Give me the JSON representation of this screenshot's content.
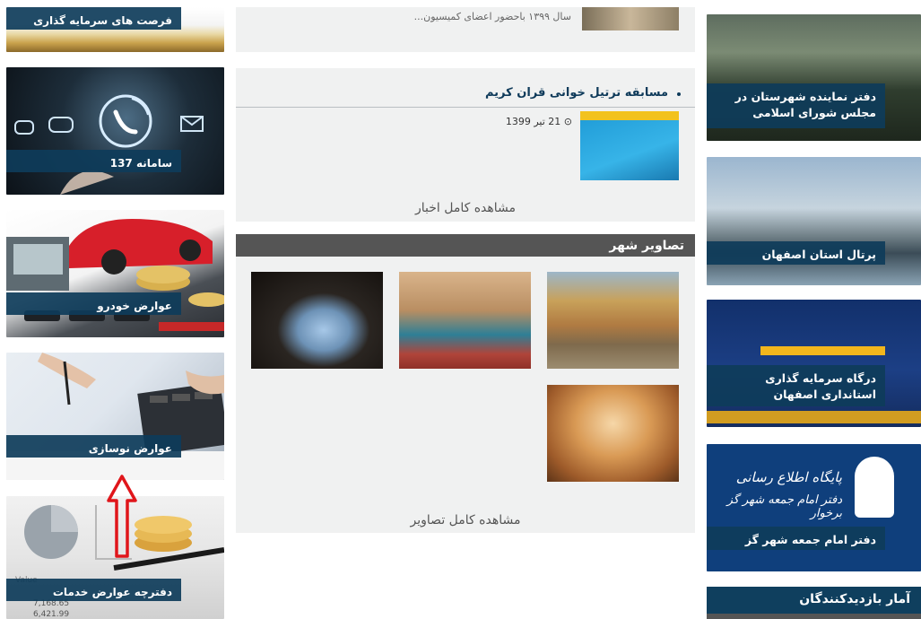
{
  "left_tiles": [
    {
      "label": "فرصت های سرمایه گذاری"
    },
    {
      "label": "سامانه 137"
    },
    {
      "label": "عوارض خودرو"
    },
    {
      "label": "عوارض نوسازی"
    },
    {
      "label": "دفترچه عوارض خدمات"
    }
  ],
  "news": {
    "prev_snippet": "سال ۱۳۹۹ باحضور اعضای کمیسیون...",
    "item_title": "مسابقه ترتیل خوانی قران کریم",
    "item_date": "21 تیر 1399",
    "more_label": "مشاهده کامل اخبار"
  },
  "gallery": {
    "title": "تصاویر شهر",
    "more_label": "مشاهده کامل تصاویر",
    "images": [
      "city-image-1",
      "city-image-2",
      "city-image-3",
      "city-image-4"
    ]
  },
  "right_tiles": [
    {
      "label": "دفتر نماینده شهرستان در مجلس شورای اسلامی"
    },
    {
      "label": "پرتال استان اصفهان"
    },
    {
      "label": "درگاه سرمایه گذاری استانداری اصفهان"
    },
    {
      "label": "دفتر امام جمعه شهر گز"
    }
  ],
  "right_banner_text": {
    "line1": "پایگاه اطلاع رسانی",
    "line2": "دفتر امام جمعه شهر گز برخوار"
  },
  "stats": {
    "title": "آمار بازدیدکنندگان"
  },
  "annotation": {
    "color": "#e0161b"
  }
}
